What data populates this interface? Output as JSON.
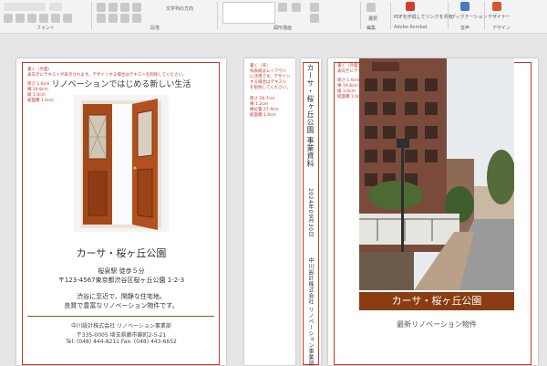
{
  "ribbon": {
    "groups": [
      {
        "label": "フォント"
      },
      {
        "label": "段落"
      },
      {
        "label": "図形描画"
      },
      {
        "label": "編集"
      },
      {
        "label": "Adobe Acrobat"
      },
      {
        "label": "音声"
      },
      {
        "label": "デザイン"
      }
    ],
    "buttons": {
      "select": "選択",
      "pdf_share": "PDFを作成してリンクを共有",
      "dictation": "ディクテーション",
      "designer": "デザイナー",
      "text_direction": "文字列の方向"
    }
  },
  "front": {
    "note_lines": [
      "書く（外面）",
      "表向きにテキストが表示されます。デザインする場合はテキストを削除してください。"
    ],
    "specs": [
      "厚さ 1.6cm",
      "横 19.8cm",
      "縦 1.0cm",
      "総面積 1.0cm"
    ],
    "headline": "リノベーションではじめる新しい生活",
    "title": "カーサ・桜ヶ丘公園",
    "line1": "桜泉駅 徒歩５分",
    "address": "〒123-4567東京都渋谷区桜ヶ丘公園 1-2-3",
    "desc1": "渋谷に至近で、閑静な住宅地。",
    "desc2": "良質で豊富なリノベーション物件です。",
    "company": "中川設計株式会社 リノベーション事業部",
    "company_addr": "〒335-0005 埼玉県蕨市錦町2-5-21",
    "company_tel": "Tel: (048) 444-8211 Fax: (048) 443-6652"
  },
  "spine_side": {
    "note_lines": [
      "書く（背）",
      "背表紙はレイアウト",
      "に活用です。デザイン",
      "する場合はテキスト",
      "を削除してください。"
    ],
    "specs": [
      "厚さ 28.7cm",
      "横 1.2cm",
      "横位置 27.9cm",
      "総面積 1.0cm"
    ]
  },
  "spine": {
    "title": "カーサ・桜ヶ丘公園 事業資料",
    "date": "2024年09月30日",
    "sub": "中川設計株式会社 リノベーション事業部"
  },
  "back": {
    "note_lines": [
      "書く（外面）",
      "表向きにテキストが表示されます。デザインする場合はテキストを削除してください。"
    ],
    "specs": [
      "厚さ 1.0cm",
      "横 19.8cm",
      "縦 1.0cm",
      "総面積 1.0cm"
    ],
    "title": "カーサ・桜ヶ丘公園",
    "subtitle": "最新リノベーション物件"
  },
  "colors": {
    "accent": "#c0392b",
    "banner": "#8a3d12",
    "door": "#a64a1c"
  },
  "icons": [
    "door-image",
    "building-photo"
  ]
}
